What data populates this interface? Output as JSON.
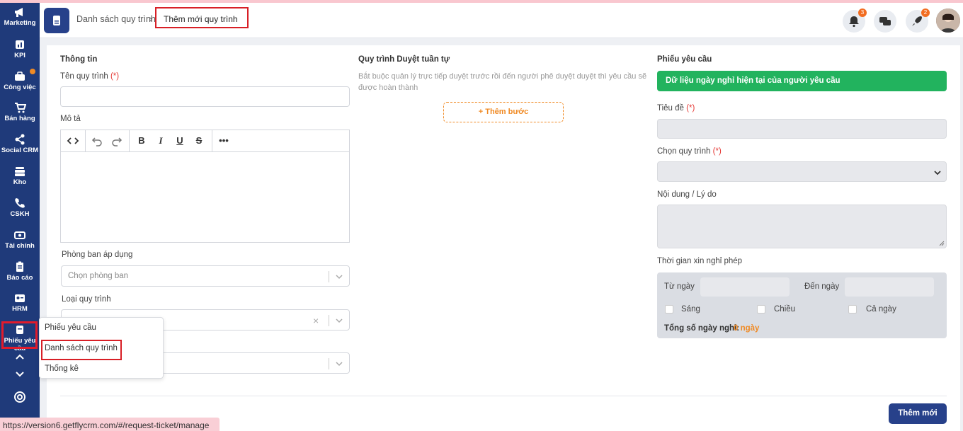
{
  "sidebar": {
    "items": [
      {
        "label": "Marketing",
        "icon": "megaphone-icon"
      },
      {
        "label": "KPI",
        "icon": "chart-icon"
      },
      {
        "label": "Công việc",
        "icon": "briefcase-icon"
      },
      {
        "label": "Bán hàng",
        "icon": "cart-icon"
      },
      {
        "label": "Social CRM",
        "icon": "share-icon"
      },
      {
        "label": "Kho",
        "icon": "warehouse-icon"
      },
      {
        "label": "CSKH",
        "icon": "phone-icon"
      },
      {
        "label": "Tài chính",
        "icon": "money-icon"
      },
      {
        "label": "Báo cáo",
        "icon": "clipboard-icon"
      },
      {
        "label": "HRM",
        "icon": "id-card-icon"
      },
      {
        "label": "Phiếu yêu cầu",
        "icon": "ticket-icon"
      }
    ]
  },
  "header": {
    "breadcrumb_parent": "Danh sách quy trình",
    "breadcrumb_sep": "›",
    "breadcrumb_current": "Thêm mới quy trình",
    "notif_count": "3",
    "rocket_count": "2"
  },
  "info": {
    "title": "Thông tin",
    "name_label": "Tên quy trình",
    "required_mark": "(*)",
    "desc_label": "Mô tả",
    "dept_label": "Phòng ban áp dụng",
    "dept_placeholder": "Chọn phòng ban",
    "type_label": "Loại quy trình"
  },
  "approval": {
    "title": "Quy trình Duyệt tuần tự",
    "description": "Bắt buộc quản lý trực tiếp duyệt trước rồi đến người phê duyệt duyệt thì yêu cầu sẽ được hoàn thành",
    "add_step": "+ Thêm bước"
  },
  "request": {
    "title": "Phiếu yêu cầu",
    "green_bar": "Dữ liệu ngày nghỉ hiện tại của người yêu cầu",
    "subject_label": "Tiêu đề",
    "process_label": "Chọn quy trình",
    "content_label": "Nội dung / Lý do",
    "leave_label": "Thời gian xin nghỉ phép",
    "from_label": "Từ ngày",
    "to_label": "Đến ngày",
    "morning": "Sáng",
    "afternoon": "Chiều",
    "fullday": "Cả ngày",
    "total_label": "Tổng số ngày nghỉ:",
    "total_value": "0 ngày"
  },
  "popup": {
    "items": [
      "Phiếu yêu cầu",
      "Danh sách quy trình",
      "Thống kê"
    ]
  },
  "actions": {
    "submit": "Thêm mới"
  },
  "status_url": "https://version6.getflycrm.com/#/request-ticket/manage",
  "colors": {
    "sidebar": "#1f3a7a",
    "primary": "#27418a",
    "green": "#22b35e",
    "orange": "#f08a24",
    "highlight": "#d81f26"
  }
}
